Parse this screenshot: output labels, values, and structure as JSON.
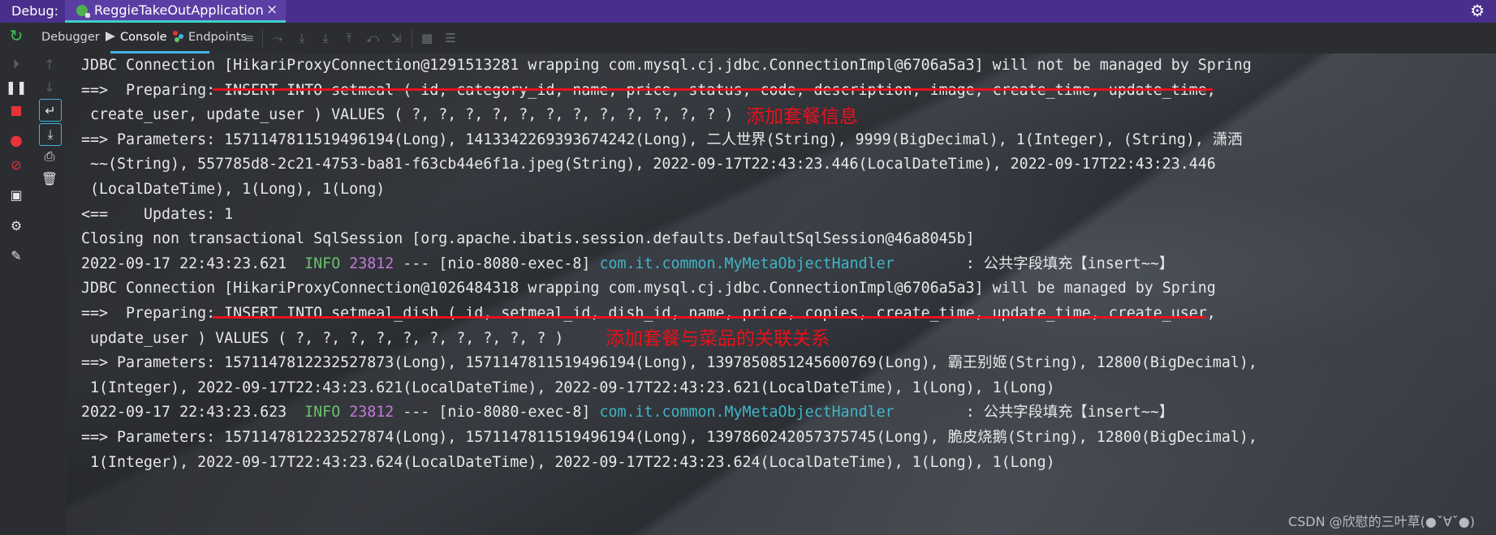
{
  "titlebar": {
    "debug_label": "Debug:",
    "run_tab_title": "ReggieTakeOutApplication",
    "close_glyph": "×",
    "settings_icon": "gear-icon"
  },
  "tool_tabs": {
    "debugger": "Debugger",
    "console": "Console",
    "endpoints": "Endpoints",
    "active": "Console"
  },
  "colors": {
    "titlebar_bg": "#4a2e8c",
    "info": "#6ac16a",
    "pid": "#c678dd",
    "class_name": "#3fb6c6",
    "annotation_red": "#e8121b",
    "accent": "#3fb6e0"
  },
  "console_lines": [
    "JDBC Connection [HikariProxyConnection@1291513281 wrapping com.mysql.cj.jdbc.ConnectionImpl@6706a5a3] will not be managed by Spring",
    "==>  Preparing: INSERT INTO setmeal ( id, category_id, name, price, status, code, description, image, create_time, update_time,",
    " create_user, update_user ) VALUES ( ?, ?, ?, ?, ?, ?, ?, ?, ?, ?, ?, ? )",
    "==> Parameters: 1571147811519496194(Long), 1413342269393674242(Long), 二人世界(String), 9999(BigDecimal), 1(Integer), (String), 潇洒",
    " ~~(String), 557785d8-2c21-4753-ba81-f63cb44e6f1a.jpeg(String), 2022-09-17T22:43:23.446(LocalDateTime), 2022-09-17T22:43:23.446",
    " (LocalDateTime), 1(Long), 1(Long)",
    "<==    Updates: 1",
    "Closing non transactional SqlSession [org.apache.ibatis.session.defaults.DefaultSqlSession@46a8045b]",
    null,
    "JDBC Connection [HikariProxyConnection@1026484318 wrapping com.mysql.cj.jdbc.ConnectionImpl@6706a5a3] will be managed by Spring",
    "==>  Preparing: INSERT INTO setmeal_dish ( id, setmeal_id, dish_id, name, price, copies, create_time, update_time, create_user,",
    " update_user ) VALUES ( ?, ?, ?, ?, ?, ?, ?, ?, ?, ? )",
    "==> Parameters: 1571147812232527873(Long), 1571147811519496194(Long), 1397850851245600769(Long), 霸王别姬(String), 12800(BigDecimal),",
    " 1(Integer), 2022-09-17T22:43:23.621(LocalDateTime), 2022-09-17T22:43:23.621(LocalDateTime), 1(Long), 1(Long)",
    null,
    "==> Parameters: 1571147812232527874(Long), 1571147811519496194(Long), 1397860242057375745(Long), 脆皮烧鹅(String), 12800(BigDecimal),",
    " 1(Integer), 2022-09-17T22:43:23.624(LocalDateTime), 2022-09-17T22:43:23.624(LocalDateTime), 1(Long), 1(Long)"
  ],
  "log_entries": [
    {
      "timestamp": "2022-09-17 22:43:23.621",
      "level": "INFO",
      "pid": "23812",
      "sep": "---",
      "thread": "[nio-8080-exec-8]",
      "logger": "com.it.common.MyMetaObjectHandler",
      "message": ": 公共字段填充【insert~~】"
    },
    {
      "timestamp": "2022-09-17 22:43:23.623",
      "level": "INFO",
      "pid": "23812",
      "sep": "---",
      "thread": "[nio-8080-exec-8]",
      "logger": "com.it.common.MyMetaObjectHandler",
      "message": ": 公共字段填充【insert~~】"
    }
  ],
  "annotations": {
    "setmeal": "添加套餐信息",
    "setmeal_dish": "添加套餐与菜品的关联关系"
  },
  "watermark": "CSDN @欣慰的三叶草(●ˇ∀ˇ●)"
}
